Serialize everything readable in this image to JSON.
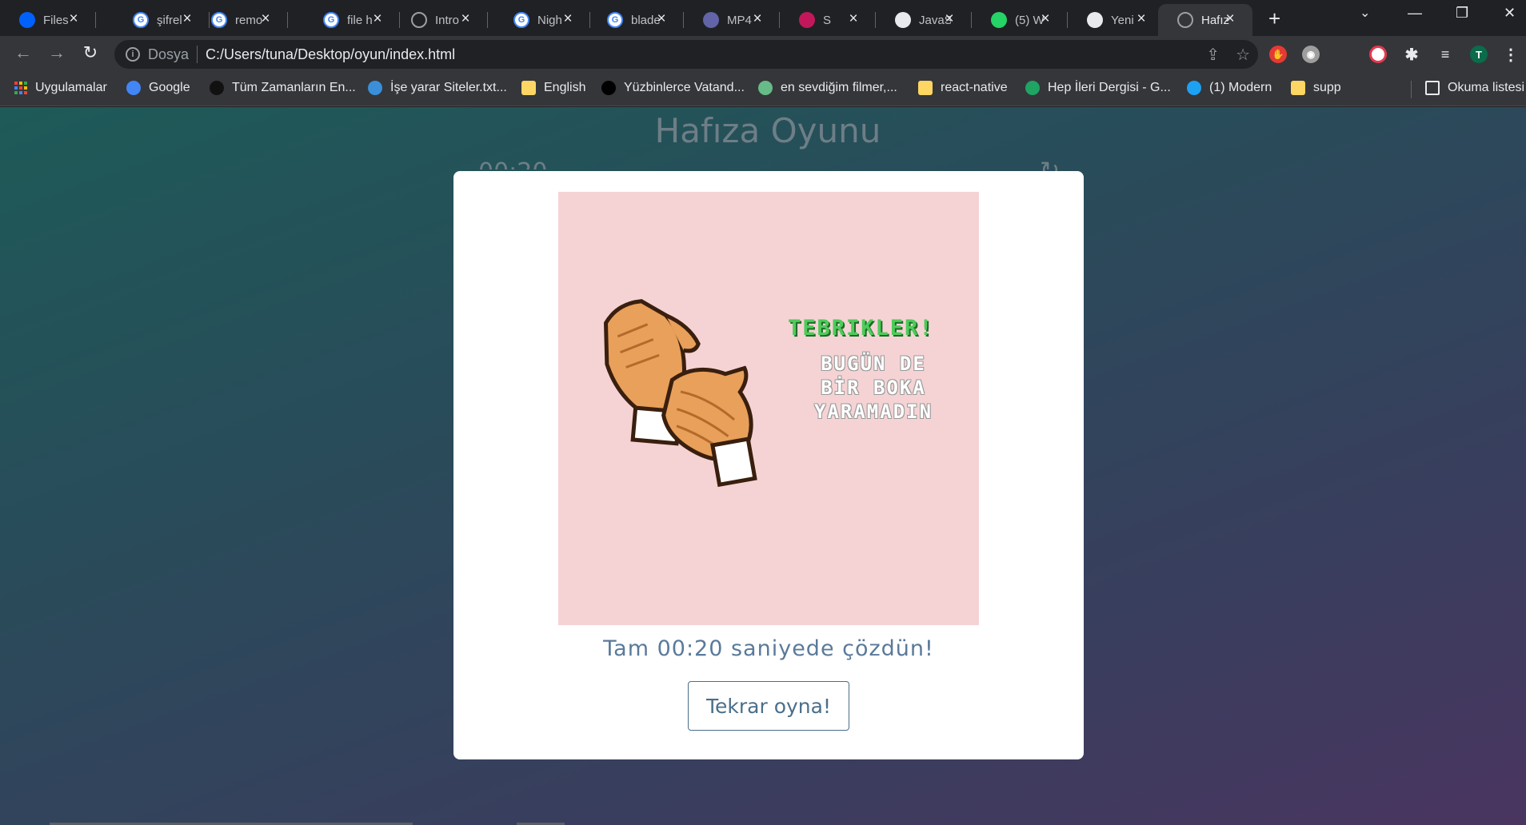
{
  "browser": {
    "tabs": [
      {
        "title": "Files",
        "icon": "dropbox-icon",
        "color": "#0061fe"
      },
      {
        "title": "şifrel",
        "icon": "google-icon",
        "color": "#4285f4"
      },
      {
        "title": "remo",
        "icon": "google-icon",
        "color": "#4285f4"
      },
      {
        "title": "file h",
        "icon": "google-icon",
        "color": "#4285f4"
      },
      {
        "title": "Intro",
        "icon": "globe-icon",
        "color": "#9aa0a6"
      },
      {
        "title": "Nigh",
        "icon": "google-icon",
        "color": "#4285f4"
      },
      {
        "title": "blade",
        "icon": "google-icon",
        "color": "#4285f4"
      },
      {
        "title": "MP4",
        "icon": "teams-icon",
        "color": "#6264a7"
      },
      {
        "title": "S",
        "icon": "audio-tab-icon",
        "color": "#c2185b"
      },
      {
        "title": "JavaS",
        "icon": "github-icon",
        "color": "#e8eaed"
      },
      {
        "title": "(5) W",
        "icon": "whatsapp-icon",
        "color": "#25d366"
      },
      {
        "title": "Yeni",
        "icon": "chrome-icon",
        "color": "#e8eaed"
      },
      {
        "title": "Hafız",
        "icon": "globe-icon",
        "color": "#9aa0a6",
        "active": true
      }
    ],
    "address": {
      "protocol_label": "Dosya",
      "url": "C:/Users/tuna/Desktop/oyun/index.html"
    },
    "profile_initial": "T",
    "bookmarks": [
      {
        "label": "Uygulamalar",
        "icon": "apps-grid-icon"
      },
      {
        "label": "Google",
        "icon": "google-icon"
      },
      {
        "label": "Tüm Zamanların En...",
        "icon": "film-reel-icon"
      },
      {
        "label": "İşe yarar Siteler.txt...",
        "icon": "wave-icon"
      },
      {
        "label": "English",
        "icon": "folder-icon"
      },
      {
        "label": "Yüzbinlerce Vatand...",
        "icon": "medium-icon"
      },
      {
        "label": "en sevdiğim filmer,...",
        "icon": "dots-icon"
      },
      {
        "label": "react-native",
        "icon": "folder-icon"
      },
      {
        "label": "Hep İleri Dergisi - G...",
        "icon": "google-drive-icon"
      },
      {
        "label": "(1) Modern",
        "icon": "twitter-icon"
      },
      {
        "label": "supp",
        "icon": "folder-icon"
      }
    ],
    "reading_list": "Okuma listesi"
  },
  "game": {
    "title": "Hafıza Oyunu",
    "timer": "00:20",
    "modal": {
      "gif_title": "TEBRIKLER!",
      "gif_subtitle": "BUGÜN DE\nBİR BOKA\nYARAMADIN",
      "result_message": "Tam 00:20 saniyede çözdün!",
      "play_again_label": "Tekrar oyna!"
    }
  }
}
